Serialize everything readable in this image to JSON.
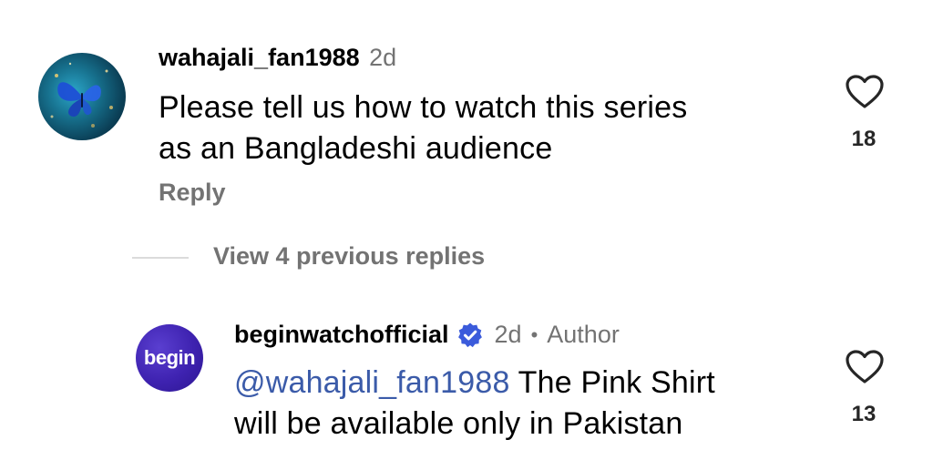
{
  "comments": [
    {
      "username": "wahajali_fan1988",
      "time": "2d",
      "line1": "Please tell us how to watch this series",
      "line2": "as an Bangladeshi audience",
      "reply_label": "Reply",
      "likes": "18"
    }
  ],
  "view_replies_label": "View 4 previous replies",
  "reply": {
    "avatar_text": "begin",
    "username": "beginwatchofficial",
    "time": "2d",
    "separator": "•",
    "author_label": "Author",
    "mention": "@wahajali_fan1988",
    "line1_rest": " The Pink Shirt",
    "line2": "will be available only in Pakistan",
    "likes": "13"
  },
  "colors": {
    "secondary_text": "#737373",
    "mention": "#3b5ba9",
    "verified_badge": "#3b5bdb",
    "avatar_begin": "#3e22b0"
  },
  "icons": [
    "heart-icon",
    "verified-badge-icon"
  ]
}
